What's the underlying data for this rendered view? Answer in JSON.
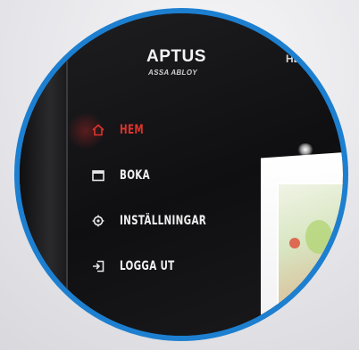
{
  "brand": {
    "name": "APTUS",
    "sub": "ASSA ABLOY"
  },
  "header": {
    "partial_text": "HE"
  },
  "menu": {
    "items": [
      {
        "label": "HEM",
        "icon": "home-icon",
        "active": true
      },
      {
        "label": "BOKA",
        "icon": "calendar-icon",
        "active": false
      },
      {
        "label": "INSTÄLLNINGAR",
        "icon": "gear-icon",
        "active": false
      },
      {
        "label": "LOGGA UT",
        "icon": "logout-icon",
        "active": false
      }
    ]
  },
  "colors": {
    "frame_ring": "#1d7fd0",
    "active_accent": "#e0322b",
    "screen_bg": "#151517",
    "menu_text": "#efefef"
  }
}
